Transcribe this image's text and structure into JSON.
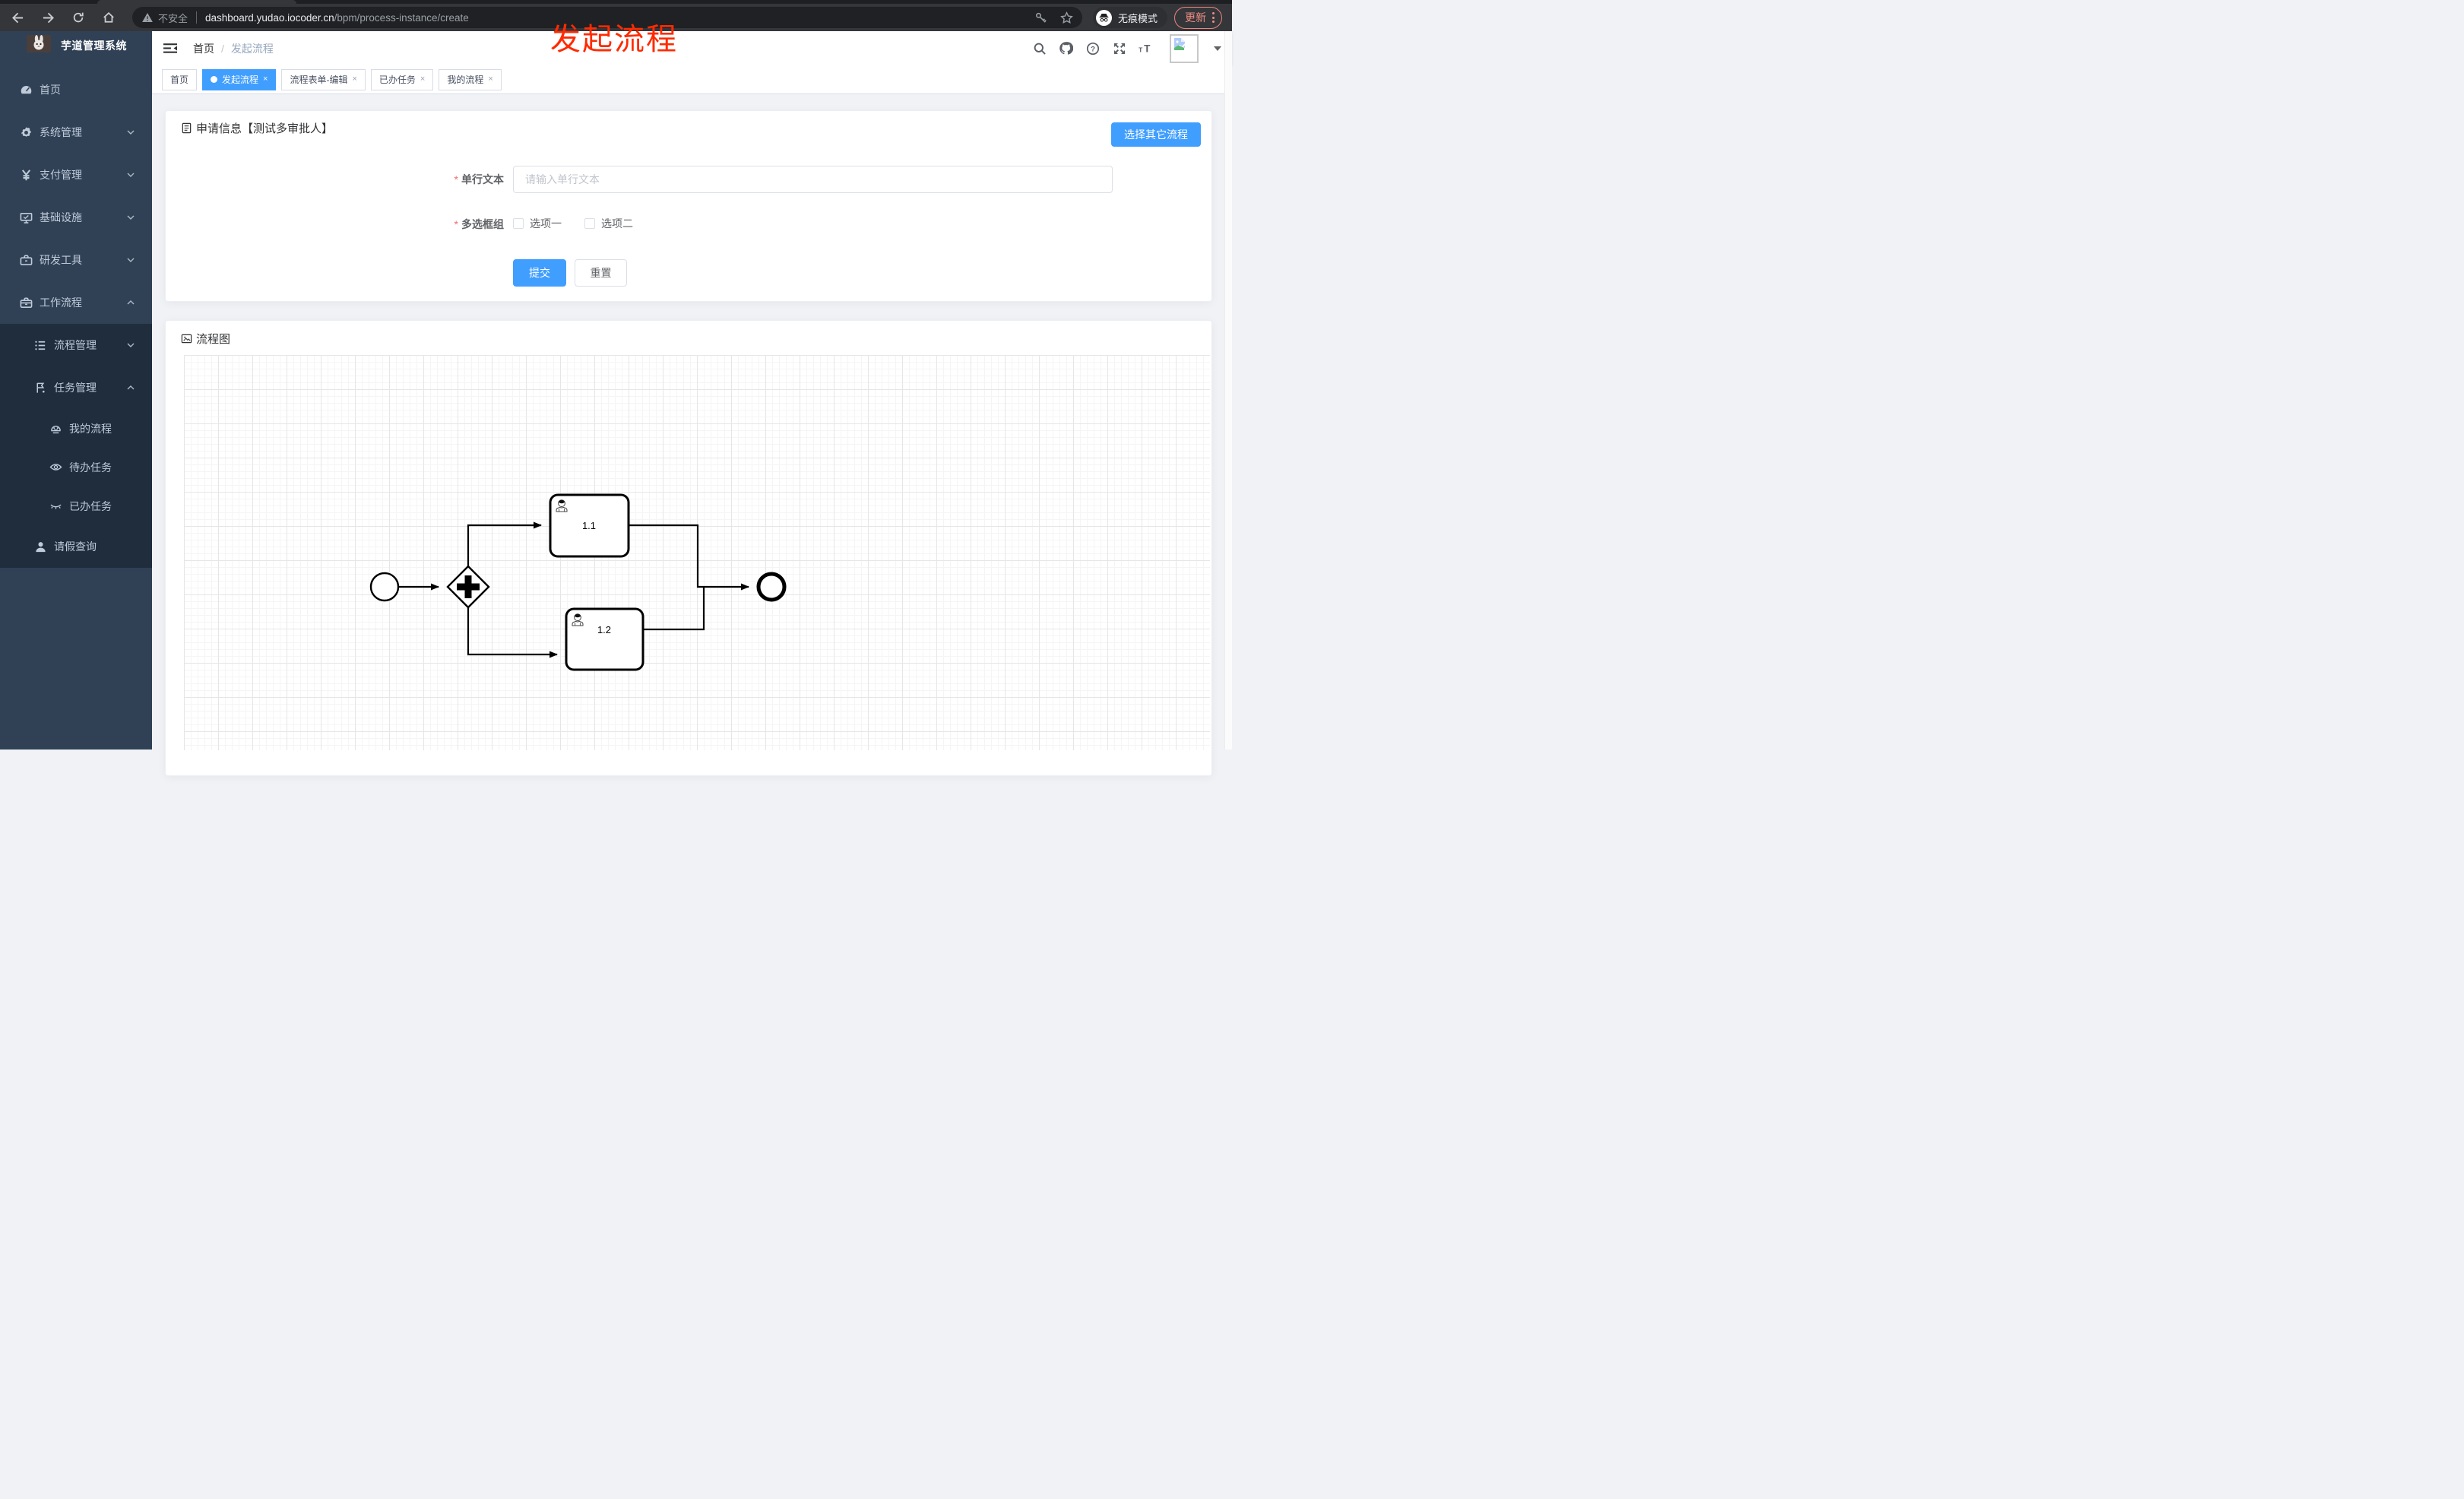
{
  "browser": {
    "security_label": "不安全",
    "url_domain": "dashboard.yudao.iocoder.cn",
    "url_path": "/bpm/process-instance/create",
    "incognito_label": "无痕模式",
    "update_label": "更新"
  },
  "annotation": {
    "title": "发起流程",
    "color": "#ff2a00"
  },
  "sidebar": {
    "app_title": "芋道管理系统",
    "items": [
      {
        "label": "首页",
        "icon": "dashboard-icon",
        "level": 1,
        "chevron": null,
        "submenu": false
      },
      {
        "label": "系统管理",
        "icon": "gear-icon",
        "level": 1,
        "chevron": "down",
        "submenu": false
      },
      {
        "label": "支付管理",
        "icon": "yen-icon",
        "level": 1,
        "chevron": "down",
        "submenu": false
      },
      {
        "label": "基础设施",
        "icon": "monitor-icon",
        "level": 1,
        "chevron": "down",
        "submenu": false
      },
      {
        "label": "研发工具",
        "icon": "toolbox-icon",
        "level": 1,
        "chevron": "down",
        "submenu": false
      },
      {
        "label": "工作流程",
        "icon": "briefcase-icon",
        "level": 1,
        "chevron": "up",
        "submenu": false
      },
      {
        "label": "流程管理",
        "icon": "list-icon",
        "level": 2,
        "chevron": "down",
        "submenu": true
      },
      {
        "label": "任务管理",
        "icon": "flag-icon",
        "level": 2,
        "chevron": "up",
        "submenu": true
      },
      {
        "label": "我的流程",
        "icon": "face-icon",
        "level": 3,
        "chevron": null,
        "submenu": true
      },
      {
        "label": "待办任务",
        "icon": "eye-icon",
        "level": 3,
        "chevron": null,
        "submenu": true
      },
      {
        "label": "已办任务",
        "icon": "eye-closed-icon",
        "level": 3,
        "chevron": null,
        "submenu": true
      },
      {
        "label": "请假查询",
        "icon": "person-icon",
        "level": 2,
        "chevron": null,
        "submenu": true
      }
    ]
  },
  "header": {
    "breadcrumb": [
      "首页",
      "发起流程"
    ]
  },
  "tabs": [
    {
      "label": "首页",
      "active": false,
      "closable": false
    },
    {
      "label": "发起流程",
      "active": true,
      "closable": true
    },
    {
      "label": "流程表单-编辑",
      "active": false,
      "closable": true
    },
    {
      "label": "已办任务",
      "active": false,
      "closable": true
    },
    {
      "label": "我的流程",
      "active": false,
      "closable": true
    }
  ],
  "form_card": {
    "title": "申请信息【测试多审批人】",
    "select_other_button": "选择其它流程",
    "text_field": {
      "label": "单行文本",
      "required": true,
      "placeholder": "请输入单行文本",
      "value": ""
    },
    "checkbox_group": {
      "label": "多选框组",
      "required": true,
      "options": [
        {
          "label": "选项一",
          "checked": false
        },
        {
          "label": "选项二",
          "checked": false
        }
      ]
    },
    "submit_label": "提交",
    "reset_label": "重置"
  },
  "diagram_card": {
    "title": "流程图",
    "nodes": [
      {
        "id": "start",
        "type": "start-event"
      },
      {
        "id": "gateway",
        "type": "parallel-gateway"
      },
      {
        "id": "task1",
        "type": "user-task",
        "label": "1.1"
      },
      {
        "id": "task2",
        "type": "user-task",
        "label": "1.2"
      },
      {
        "id": "end",
        "type": "end-event"
      }
    ],
    "flows": [
      "start→gateway",
      "gateway→task1",
      "gateway→task2",
      "task1→end",
      "task2→end"
    ]
  },
  "colors": {
    "primary": "#409eff",
    "danger": "#f56c6c",
    "sidebar_bg": "#304156",
    "submenu_bg": "#1f2d3d",
    "update_accent": "#f08d84"
  }
}
